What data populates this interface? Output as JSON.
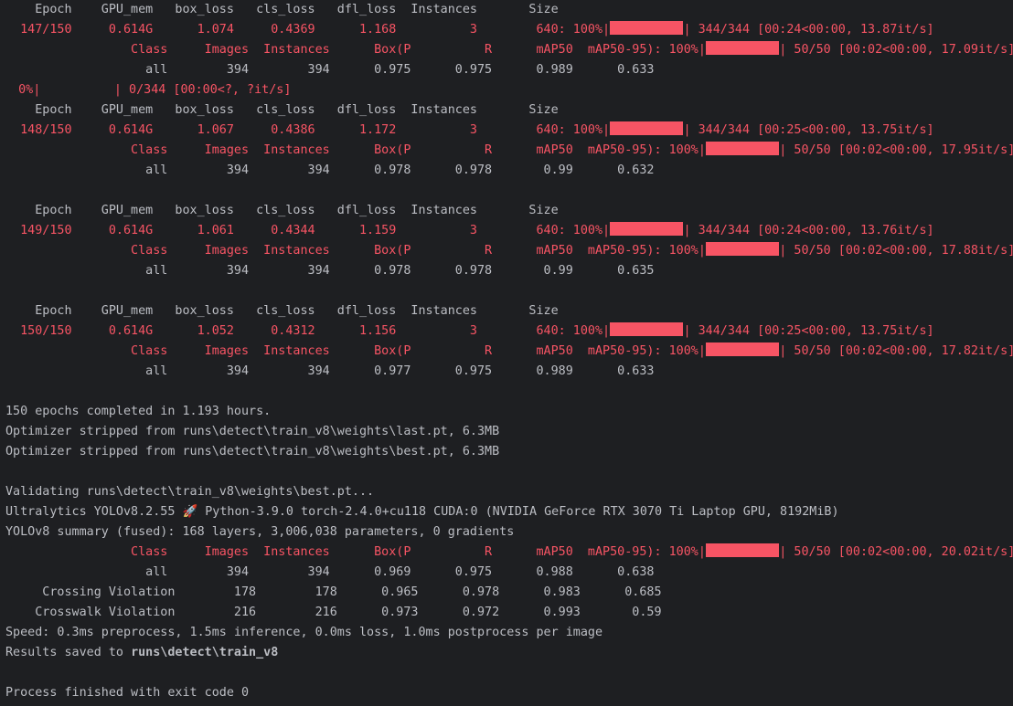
{
  "console": {
    "lines": [
      {
        "kind": "text",
        "segments": [
          {
            "t": "    Epoch    GPU_mem   box_loss   cls_loss   dfl_loss  Instances       Size",
            "c": "nm"
          }
        ]
      },
      {
        "kind": "progress",
        "segments": [
          {
            "t": "  147/150     0.614G      1.074     0.4369      1.168          3        640: 100%|",
            "c": "tr"
          },
          {
            "bar": 1.0
          },
          {
            "t": "| 344/344 [00:24<00:00, 13.87it/s]",
            "c": "tr"
          }
        ]
      },
      {
        "kind": "progress",
        "segments": [
          {
            "t": "                 Class     Images  Instances      Box(P          R      mAP50  mAP50-95): 100%|",
            "c": "tr"
          },
          {
            "bar": 1.0
          },
          {
            "t": "| 50/50 [00:02<00:00, 17.09it/s]",
            "c": "tr"
          }
        ]
      },
      {
        "kind": "text",
        "segments": [
          {
            "t": "                   all        394        394      0.975      0.975      0.989      0.633",
            "c": "nm"
          }
        ]
      },
      {
        "kind": "progress",
        "segments": [
          {
            "t": "  0%|          | 0/344 [00:00<?, ?it/s]",
            "c": "tr"
          }
        ],
        "offset": -2
      },
      {
        "kind": "text",
        "segments": [
          {
            "t": "    Epoch    GPU_mem   box_loss   cls_loss   dfl_loss  Instances       Size",
            "c": "nm"
          }
        ]
      },
      {
        "kind": "progress",
        "segments": [
          {
            "t": "  148/150     0.614G      1.067     0.4386      1.172          3        640: 100%|",
            "c": "tr"
          },
          {
            "bar": 1.0
          },
          {
            "t": "| 344/344 [00:25<00:00, 13.75it/s]",
            "c": "tr"
          }
        ]
      },
      {
        "kind": "progress",
        "segments": [
          {
            "t": "                 Class     Images  Instances      Box(P          R      mAP50  mAP50-95): 100%|",
            "c": "tr"
          },
          {
            "bar": 1.0
          },
          {
            "t": "| 50/50 [00:02<00:00, 17.95it/s]",
            "c": "tr"
          }
        ]
      },
      {
        "kind": "text",
        "segments": [
          {
            "t": "                   all        394        394      0.978      0.978       0.99      0.632",
            "c": "nm"
          }
        ]
      },
      {
        "kind": "text",
        "segments": [
          {
            "t": "",
            "c": "nm"
          }
        ]
      },
      {
        "kind": "text",
        "segments": [
          {
            "t": "    Epoch    GPU_mem   box_loss   cls_loss   dfl_loss  Instances       Size",
            "c": "nm"
          }
        ]
      },
      {
        "kind": "progress",
        "segments": [
          {
            "t": "  149/150     0.614G      1.061     0.4344      1.159          3        640: 100%|",
            "c": "tr"
          },
          {
            "bar": 1.0
          },
          {
            "t": "| 344/344 [00:24<00:00, 13.76it/s]",
            "c": "tr"
          }
        ]
      },
      {
        "kind": "progress",
        "segments": [
          {
            "t": "                 Class     Images  Instances      Box(P          R      mAP50  mAP50-95): 100%|",
            "c": "tr"
          },
          {
            "bar": 1.0
          },
          {
            "t": "| 50/50 [00:02<00:00, 17.88it/s]",
            "c": "tr"
          }
        ]
      },
      {
        "kind": "text",
        "segments": [
          {
            "t": "                   all        394        394      0.978      0.978       0.99      0.635",
            "c": "nm"
          }
        ]
      },
      {
        "kind": "text",
        "segments": [
          {
            "t": "",
            "c": "nm"
          }
        ]
      },
      {
        "kind": "text",
        "segments": [
          {
            "t": "    Epoch    GPU_mem   box_loss   cls_loss   dfl_loss  Instances       Size",
            "c": "nm"
          }
        ]
      },
      {
        "kind": "progress",
        "segments": [
          {
            "t": "  150/150     0.614G      1.052     0.4312      1.156          3        640: 100%|",
            "c": "tr"
          },
          {
            "bar": 1.0
          },
          {
            "t": "| 344/344 [00:25<00:00, 13.75it/s]",
            "c": "tr"
          }
        ]
      },
      {
        "kind": "progress",
        "segments": [
          {
            "t": "                 Class     Images  Instances      Box(P          R      mAP50  mAP50-95): 100%|",
            "c": "tr"
          },
          {
            "bar": 1.0
          },
          {
            "t": "| 50/50 [00:02<00:00, 17.82it/s]",
            "c": "tr"
          }
        ]
      },
      {
        "kind": "text",
        "segments": [
          {
            "t": "                   all        394        394      0.977      0.975      0.989      0.633",
            "c": "nm"
          }
        ]
      },
      {
        "kind": "text",
        "segments": [
          {
            "t": "",
            "c": "nm"
          }
        ]
      },
      {
        "kind": "text",
        "segments": [
          {
            "t": "150 epochs completed in 1.193 hours.",
            "c": "nm"
          }
        ]
      },
      {
        "kind": "text",
        "segments": [
          {
            "t": "Optimizer stripped from runs\\detect\\train_v8\\weights\\last.pt, 6.3MB",
            "c": "nm"
          }
        ]
      },
      {
        "kind": "text",
        "segments": [
          {
            "t": "Optimizer stripped from runs\\detect\\train_v8\\weights\\best.pt, 6.3MB",
            "c": "nm"
          }
        ]
      },
      {
        "kind": "text",
        "segments": [
          {
            "t": "",
            "c": "nm"
          }
        ]
      },
      {
        "kind": "text",
        "segments": [
          {
            "t": "Validating runs\\detect\\train_v8\\weights\\best.pt...",
            "c": "nm"
          }
        ]
      },
      {
        "kind": "text",
        "segments": [
          {
            "t": "Ultralytics YOLOv8.2.55 🚀 Python-3.9.0 torch-2.4.0+cu118 CUDA:0 (NVIDIA GeForce RTX 3070 Ti Laptop GPU, 8192MiB)",
            "c": "nm"
          }
        ]
      },
      {
        "kind": "text",
        "segments": [
          {
            "t": "YOLOv8 summary (fused): 168 layers, 3,006,038 parameters, 0 gradients",
            "c": "nm"
          }
        ]
      },
      {
        "kind": "progress",
        "segments": [
          {
            "t": "                 Class     Images  Instances      Box(P          R      mAP50  mAP50-95): 100%|",
            "c": "tr"
          },
          {
            "bar": 1.0
          },
          {
            "t": "| 50/50 [00:02<00:00, 20.02it/s]",
            "c": "tr"
          }
        ]
      },
      {
        "kind": "text",
        "segments": [
          {
            "t": "                   all        394        394      0.969      0.975      0.988      0.638",
            "c": "nm"
          }
        ]
      },
      {
        "kind": "text",
        "segments": [
          {
            "t": "     Crossing Violation        178        178      0.965      0.978      0.983      0.685",
            "c": "nm"
          }
        ]
      },
      {
        "kind": "text",
        "segments": [
          {
            "t": "    Crosswalk Violation        216        216      0.973      0.972      0.993       0.59",
            "c": "nm"
          }
        ]
      },
      {
        "kind": "text",
        "segments": [
          {
            "t": "Speed: 0.3ms preprocess, 1.5ms inference, 0.0ms loss, 1.0ms postprocess per image",
            "c": "nm"
          }
        ]
      },
      {
        "kind": "text",
        "segments": [
          {
            "t": "Results saved to ",
            "c": "nm"
          },
          {
            "t": "runs\\detect\\train_v8",
            "c": "nm",
            "b": true
          }
        ]
      },
      {
        "kind": "text",
        "segments": [
          {
            "t": "",
            "c": "nm"
          }
        ]
      },
      {
        "kind": "text",
        "segments": [
          {
            "t": "Process finished with exit code 0",
            "c": "nm"
          }
        ]
      }
    ]
  },
  "colors": {
    "background": "#1e1f22",
    "text": "#bcbec4",
    "tqdm_red": "#f75464"
  }
}
